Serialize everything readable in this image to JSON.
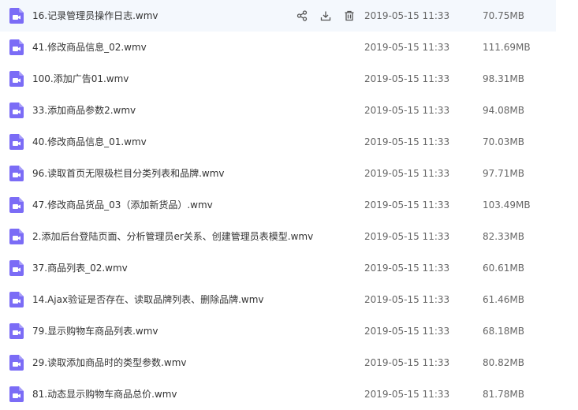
{
  "colors": {
    "icon_purple": "#7b6cf6",
    "row_highlight": "#f4f8fd",
    "action_icon": "#555555"
  },
  "row_actions": {
    "share_icon": "share-icon",
    "download_icon": "download-icon",
    "delete_icon": "trash-icon"
  },
  "files": [
    {
      "name": "16.记录管理员操作日志.wmv",
      "date": "2019-05-15 11:33",
      "size": "70.75MB",
      "active": true
    },
    {
      "name": "41.修改商品信息_02.wmv",
      "date": "2019-05-15 11:33",
      "size": "111.69MB"
    },
    {
      "name": "100.添加广告01.wmv",
      "date": "2019-05-15 11:33",
      "size": "98.31MB"
    },
    {
      "name": "33.添加商品参数2.wmv",
      "date": "2019-05-15 11:33",
      "size": "94.08MB"
    },
    {
      "name": "40.修改商品信息_01.wmv",
      "date": "2019-05-15 11:33",
      "size": "70.03MB"
    },
    {
      "name": "96.读取首页无限极栏目分类列表和品牌.wmv",
      "date": "2019-05-15 11:33",
      "size": "97.71MB"
    },
    {
      "name": "47.修改商品货品_03（添加新货品）.wmv",
      "date": "2019-05-15 11:33",
      "size": "103.49MB"
    },
    {
      "name": "2.添加后台登陆页面、分析管理员er关系、创建管理员表模型.wmv",
      "date": "2019-05-15 11:33",
      "size": "82.33MB"
    },
    {
      "name": "37.商品列表_02.wmv",
      "date": "2019-05-15 11:33",
      "size": "60.61MB"
    },
    {
      "name": "14.Ajax验证是否存在、读取品牌列表、删除品牌.wmv",
      "date": "2019-05-15 11:33",
      "size": "61.46MB"
    },
    {
      "name": "79.显示购物车商品列表.wmv",
      "date": "2019-05-15 11:33",
      "size": "68.18MB"
    },
    {
      "name": "29.读取添加商品时的类型参数.wmv",
      "date": "2019-05-15 11:33",
      "size": "80.82MB"
    },
    {
      "name": "81.动态显示购物车商品总价.wmv",
      "date": "2019-05-15 11:33",
      "size": "81.78MB"
    }
  ]
}
